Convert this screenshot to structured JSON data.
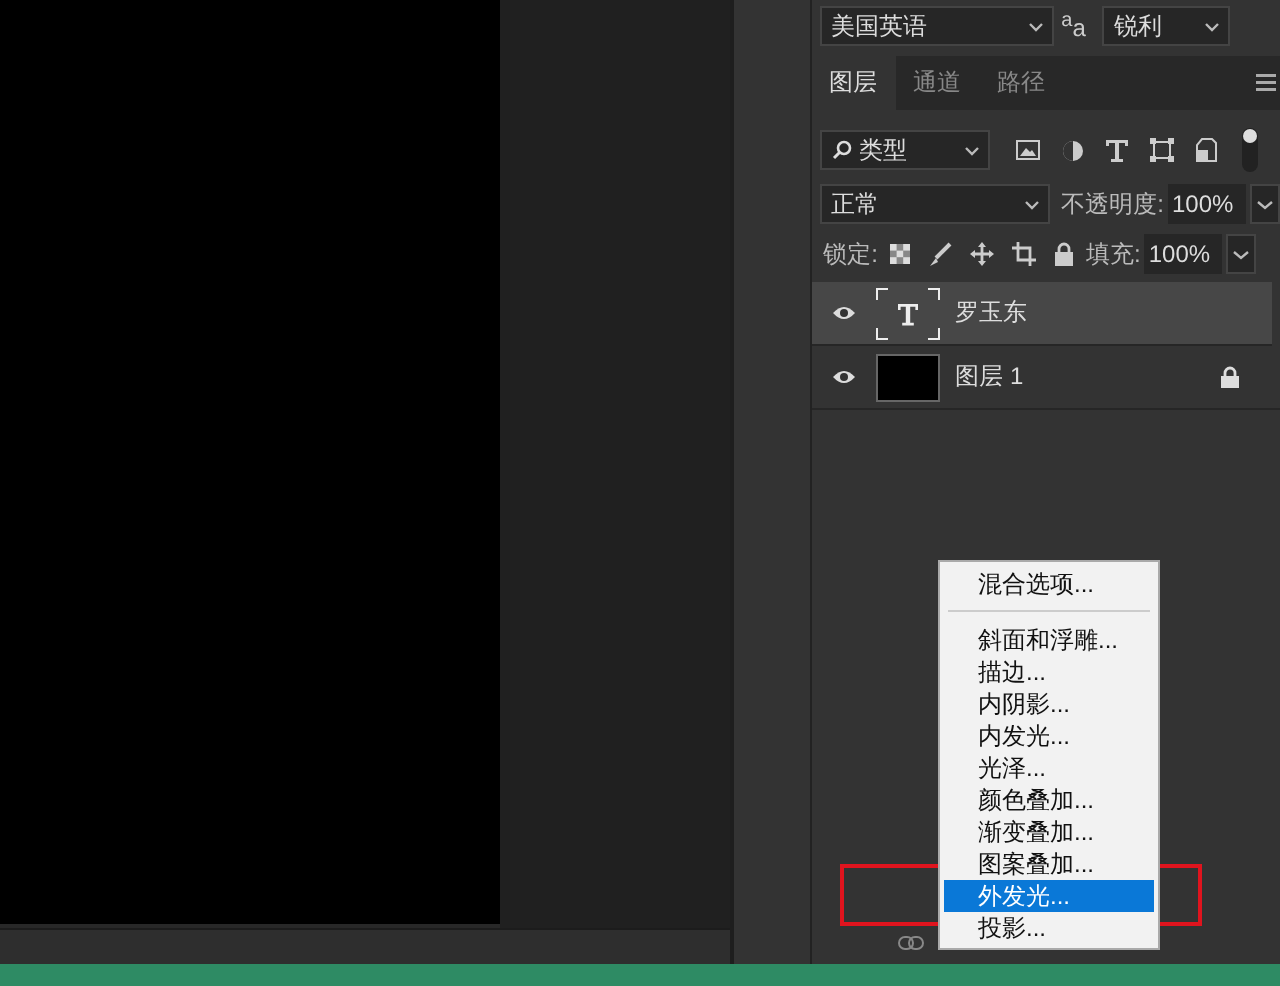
{
  "character_bar": {
    "font": "美国英语",
    "antialias_label": "$^{a}$a",
    "antialias": "锐利"
  },
  "panel_tabs": [
    {
      "label": "图层",
      "selected": true
    },
    {
      "label": "通道",
      "selected": false
    },
    {
      "label": "路径",
      "selected": false
    }
  ],
  "filter": {
    "value": "类型"
  },
  "blend": {
    "mode": "正常",
    "opacity_label": "不透明度:",
    "opacity": "100%"
  },
  "lock": {
    "label": "锁定:",
    "fill_label": "填充:",
    "fill": "100%"
  },
  "layers": [
    {
      "name": "罗玉东",
      "kind": "text",
      "selected": true,
      "visible": true,
      "locked": false
    },
    {
      "name": "图层 1",
      "kind": "fill",
      "selected": false,
      "visible": true,
      "locked": true
    }
  ],
  "context_menu": {
    "items": [
      {
        "label": "混合选项...",
        "selected": false,
        "separator_after": true
      },
      {
        "label": "斜面和浮雕...",
        "selected": false,
        "separator_after": false
      },
      {
        "label": "描边...",
        "selected": false,
        "separator_after": false
      },
      {
        "label": "内阴影...",
        "selected": false,
        "separator_after": false
      },
      {
        "label": "内发光...",
        "selected": false,
        "separator_after": false
      },
      {
        "label": "光泽...",
        "selected": false,
        "separator_after": false
      },
      {
        "label": "颜色叠加...",
        "selected": false,
        "separator_after": false
      },
      {
        "label": "渐变叠加...",
        "selected": false,
        "separator_after": false
      },
      {
        "label": "图案叠加...",
        "selected": false,
        "separator_after": false
      },
      {
        "label": "外发光...",
        "selected": true,
        "separator_after": false
      },
      {
        "label": "投影...",
        "selected": false,
        "separator_after": false
      }
    ]
  }
}
